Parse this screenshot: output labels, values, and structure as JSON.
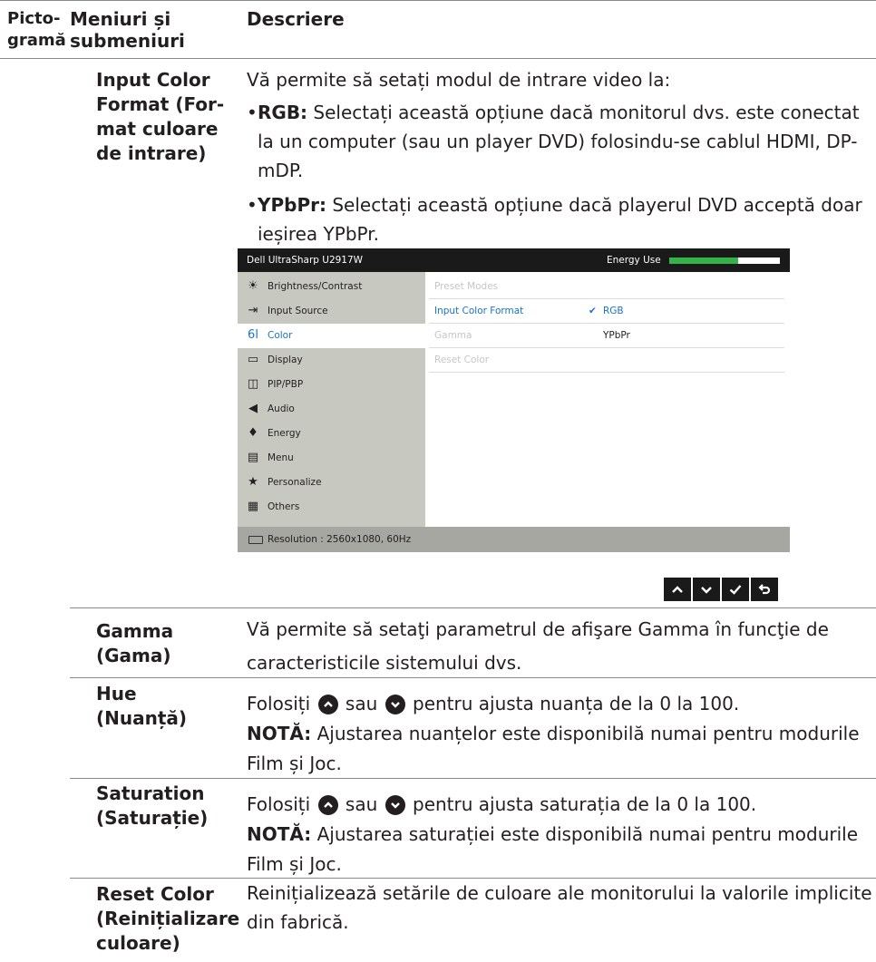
{
  "header": {
    "col1": "Picto-\ngramă",
    "col2": "Meniuri și\nsubmeniuri",
    "col3": "Descriere"
  },
  "input_color_format": {
    "term": "Input Color\nFormat (For-\nmat culoare\nde intrare)",
    "intro": "Vă permite să setați modul de intrare video la:",
    "rgb_label": "RGB:",
    "rgb_text": " Selectați această opțiune dacă monitorul dvs. este conectat la un computer (sau un player DVD) folosindu-se cablul HDMI, DP-mDP.",
    "ypbpr_label": "YPbPr:",
    "ypbpr_text": " Selectați această opțiune dacă playerul DVD acceptă doar ieșirea YPbPr."
  },
  "osd": {
    "title": "Dell UltraSharp U2917W",
    "energy_label": "Energy Use",
    "energy_level": 0.62,
    "menu": [
      {
        "label": "Brightness/Contrast",
        "icon": "brightness-icon"
      },
      {
        "label": "Input Source",
        "icon": "input-source-icon"
      },
      {
        "label": "Color",
        "icon": "color-icon",
        "selected": true
      },
      {
        "label": "Display",
        "icon": "display-icon"
      },
      {
        "label": "PIP/PBP",
        "icon": "pip-icon"
      },
      {
        "label": "Audio",
        "icon": "audio-icon"
      },
      {
        "label": "Energy",
        "icon": "energy-icon"
      },
      {
        "label": "Menu",
        "icon": "menu-icon"
      },
      {
        "label": "Personalize",
        "icon": "star-icon"
      },
      {
        "label": "Others",
        "icon": "others-icon"
      }
    ],
    "panel": [
      {
        "label": "Preset Modes",
        "value": ""
      },
      {
        "label": "Input Color Format",
        "value": "RGB",
        "active": true,
        "checked": true
      },
      {
        "label": "Gamma",
        "value": "YPbPr"
      },
      {
        "label": "Reset Color",
        "value": ""
      }
    ],
    "status": "Resolution : 2560x1080, 60Hz"
  },
  "nav_buttons": [
    "up-icon",
    "down-icon",
    "check-icon",
    "back-icon"
  ],
  "gamma": {
    "term": "Gamma\n(Gama)",
    "desc": "Vă permite să setaţi parametrul de afişare Gamma în funcţie de caracteristicile sistemului dvs."
  },
  "hue": {
    "term": "Hue\n(Nuanță)",
    "p1a": "Folosiți ",
    "p1b": " sau ",
    "p1c": " pentru ajusta nuanța de la 0 la 100.",
    "note_label": "NOTĂ:",
    "note_text": " Ajustarea nuanțelor este disponibilă numai pentru modurile Film și Joc."
  },
  "saturation": {
    "term": "Saturation\n(Saturație)",
    "p1a": "Folosiți ",
    "p1b": " sau ",
    "p1c": "  pentru ajusta saturația de la 0 la 100.",
    "note_label": "NOTĂ:",
    "note_text": " Ajustarea saturației este disponibilă numai pentru modurile Film și Joc."
  },
  "reset_color": {
    "term": "Reset Color\n(Reinițializare\nculoare)",
    "desc": "Reinițializează setările de culoare ale monitorului la valorile implicite din fabrică."
  }
}
